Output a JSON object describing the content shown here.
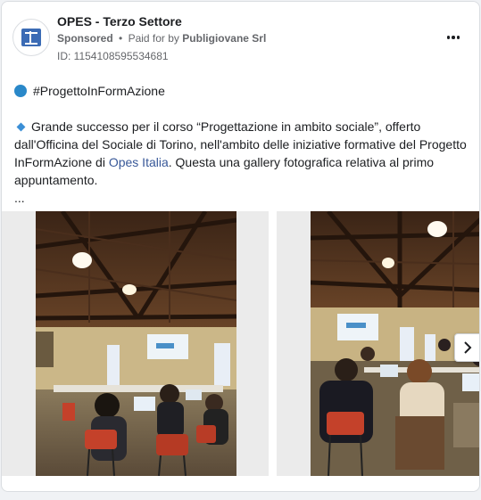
{
  "post": {
    "page_name": "OPES - Terzo Settore",
    "sponsored_label": "Sponsored",
    "separator": "•",
    "paid_for_prefix": "Paid for by",
    "payer": "Publigiovane Srl",
    "ad_id": "ID: 1154108595534681",
    "hashtag": "#ProgettoInFormAzione",
    "text_part1": "Grande successo per il corso “Progettazione in ambito sociale”, offerto dall'Officina del Sociale di Torino, nell'ambito delle iniziative formative del Progetto InFormAzione di ",
    "link_text": "Opes Italia",
    "text_part2": ". Questa una gallery fotografica relativa al primo appuntamento.",
    "see_more": "..."
  },
  "icons": {
    "avatar": "opes-logo-icon",
    "more": "more-horizontal-icon",
    "hashtag_bullet": "blue-circle-icon",
    "text_bullet": "small-blue-diamond-icon",
    "next": "chevron-right-icon"
  },
  "carousel": {
    "images": [
      {
        "name": "classroom-photo-1",
        "description_hidden": true
      },
      {
        "name": "classroom-photo-2",
        "description_hidden": true
      }
    ]
  },
  "colors": {
    "link": "#385898",
    "accent_dot": "#2a88c9"
  }
}
